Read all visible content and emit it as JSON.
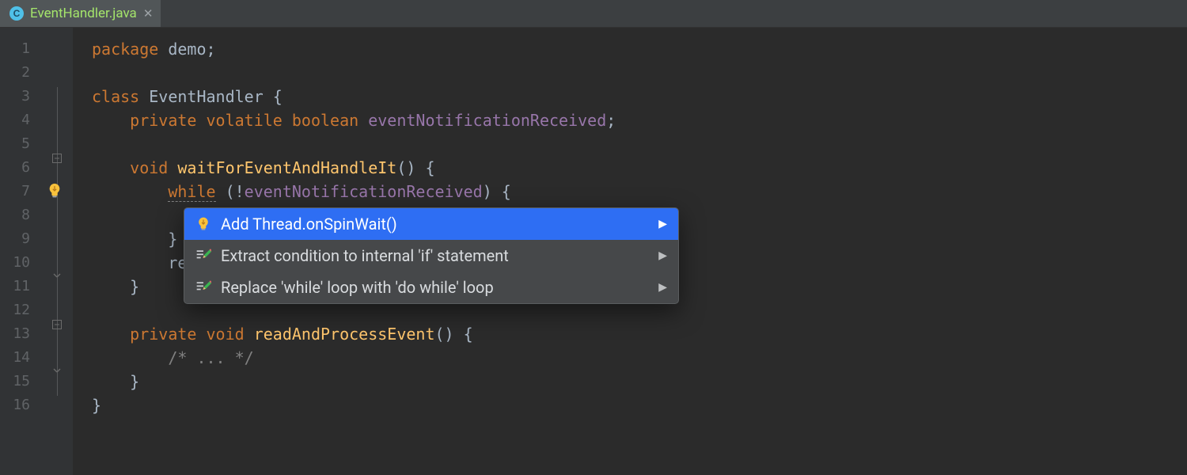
{
  "tab": {
    "label": "EventHandler.java",
    "iconLetter": "C"
  },
  "code": {
    "lines": [
      {
        "n": 1,
        "indent": 0,
        "tokens": [
          [
            "kw",
            "package"
          ],
          [
            "punc",
            " "
          ],
          [
            "name",
            "demo"
          ],
          [
            "punc",
            ";"
          ]
        ]
      },
      {
        "n": 2,
        "indent": 0,
        "tokens": []
      },
      {
        "n": 3,
        "indent": 0,
        "tokens": [
          [
            "kw",
            "class"
          ],
          [
            "punc",
            " "
          ],
          [
            "name",
            "EventHandler"
          ],
          [
            "punc",
            " {"
          ]
        ]
      },
      {
        "n": 4,
        "indent": 1,
        "tokens": [
          [
            "kw",
            "private volatile boolean"
          ],
          [
            "punc",
            " "
          ],
          [
            "field",
            "eventNotificationReceived"
          ],
          [
            "punc",
            ";"
          ]
        ]
      },
      {
        "n": 5,
        "indent": 0,
        "tokens": []
      },
      {
        "n": 6,
        "indent": 1,
        "tokens": [
          [
            "kw",
            "void"
          ],
          [
            "punc",
            " "
          ],
          [
            "method-decl",
            "waitForEventAndHandleIt"
          ],
          [
            "punc",
            "() {"
          ]
        ]
      },
      {
        "n": 7,
        "indent": 2,
        "tokens": [
          [
            "kw-warn",
            "while"
          ],
          [
            "punc",
            " (!"
          ],
          [
            "field",
            "eventNotificationReceived"
          ],
          [
            "punc",
            ") {"
          ]
        ],
        "highlighted": true,
        "bulb": true
      },
      {
        "n": 8,
        "indent": 2,
        "tokens": []
      },
      {
        "n": 9,
        "indent": 2,
        "tokens": [
          [
            "punc",
            "}"
          ]
        ]
      },
      {
        "n": 10,
        "indent": 2,
        "tokens": [
          [
            "name",
            "readAndProcessEvent"
          ],
          [
            "punc",
            "();"
          ]
        ],
        "obscured": true
      },
      {
        "n": 11,
        "indent": 1,
        "tokens": [
          [
            "punc",
            "}"
          ]
        ]
      },
      {
        "n": 12,
        "indent": 0,
        "tokens": []
      },
      {
        "n": 13,
        "indent": 1,
        "tokens": [
          [
            "kw",
            "private void"
          ],
          [
            "punc",
            " "
          ],
          [
            "method-decl",
            "readAndProcessEvent"
          ],
          [
            "punc",
            "() {"
          ]
        ]
      },
      {
        "n": 14,
        "indent": 2,
        "tokens": [
          [
            "comment",
            "/* ... */"
          ]
        ]
      },
      {
        "n": 15,
        "indent": 1,
        "tokens": [
          [
            "punc",
            "}"
          ]
        ]
      },
      {
        "n": 16,
        "indent": 0,
        "tokens": [
          [
            "punc",
            "}"
          ]
        ]
      }
    ],
    "foldMarks": [
      {
        "line": 6,
        "type": "open"
      },
      {
        "line": 11,
        "type": "close"
      },
      {
        "line": 13,
        "type": "open"
      },
      {
        "line": 15,
        "type": "close"
      }
    ],
    "foldTracks": [
      {
        "from": 3,
        "to": 16
      }
    ]
  },
  "popup": {
    "items": [
      {
        "label": "Add Thread.onSpinWait()",
        "icon": "bulb",
        "selected": true,
        "submenu": true
      },
      {
        "label": "Extract condition to internal 'if' statement",
        "icon": "pencil",
        "selected": false,
        "submenu": true
      },
      {
        "label": "Replace 'while' loop with 'do while' loop",
        "icon": "pencil",
        "selected": false,
        "submenu": true
      }
    ]
  }
}
